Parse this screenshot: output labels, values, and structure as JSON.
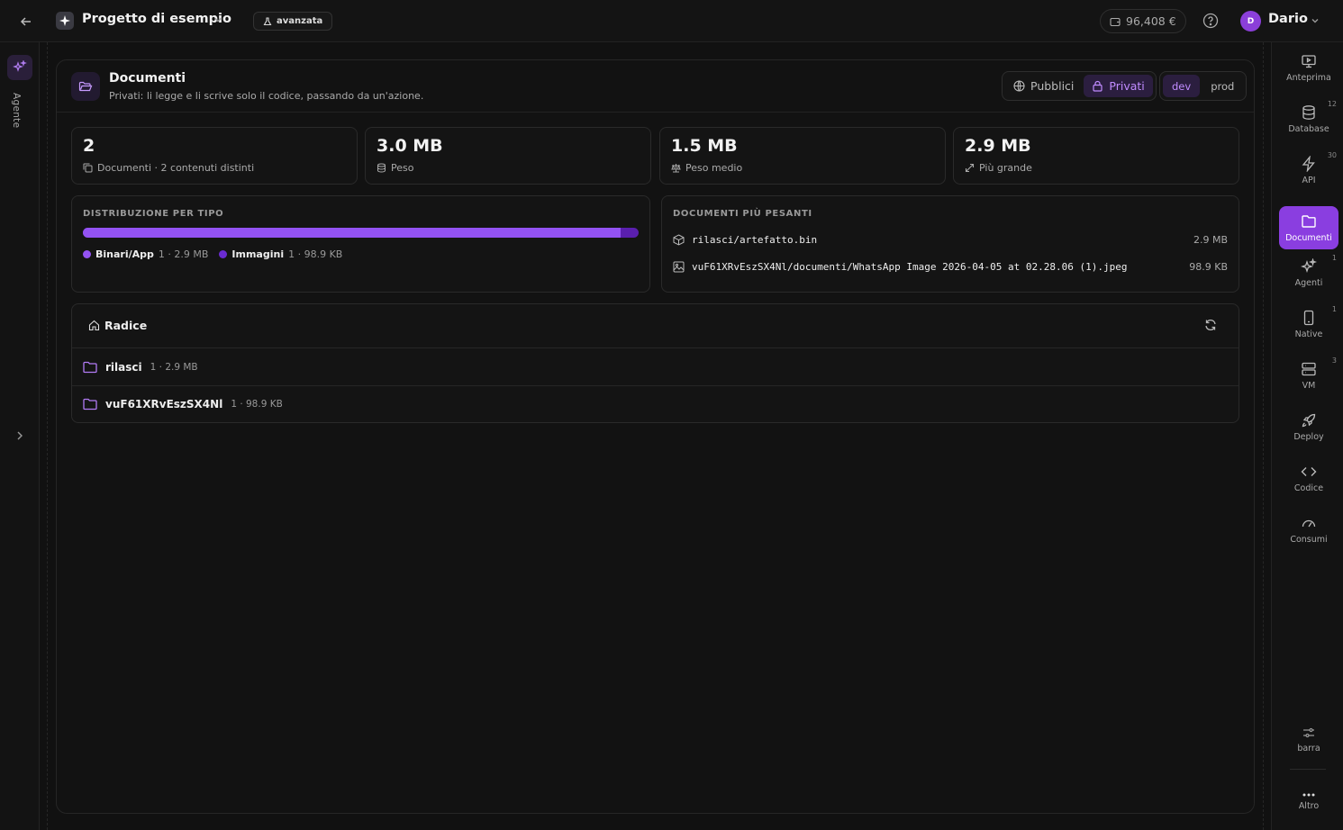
{
  "topbar": {
    "project_name": "Progetto di esempio",
    "mode_badge": "avanzata",
    "credit": "96,408 €",
    "user_initial": "D",
    "user_name": "Dario"
  },
  "left_rail": {
    "agent_label": "Agente"
  },
  "right_rail": {
    "items": [
      {
        "label": "Anteprima",
        "icon": "monitor-icon",
        "count": ""
      },
      {
        "label": "Database",
        "icon": "database-icon",
        "count": "12"
      },
      {
        "label": "API",
        "icon": "bolt-icon",
        "count": "30"
      },
      {
        "label": "Documenti",
        "icon": "folder-icon",
        "count": "",
        "active": true
      },
      {
        "label": "Agenti",
        "icon": "sparkles-icon",
        "count": "1"
      },
      {
        "label": "Native",
        "icon": "phone-icon",
        "count": "1"
      },
      {
        "label": "VM",
        "icon": "server-icon",
        "count": "3"
      },
      {
        "label": "Deploy",
        "icon": "rocket-icon",
        "count": ""
      },
      {
        "label": "Codice",
        "icon": "code-icon",
        "count": ""
      },
      {
        "label": "Consumi",
        "icon": "gauge-icon",
        "count": ""
      }
    ],
    "bottom": [
      {
        "label": "barra",
        "icon": "sliders-icon"
      },
      {
        "label": "Altro",
        "icon": "more-icon"
      }
    ]
  },
  "documents": {
    "title": "Documenti",
    "subtitle": "Privati: li legge e li scrive solo il codice, passando da un'azione.",
    "visibility": {
      "public_label": "Pubblici",
      "private_label": "Privati",
      "selected": "Privati"
    },
    "env": {
      "dev_label": "dev",
      "prod_label": "prod",
      "selected": "dev"
    }
  },
  "stats": [
    {
      "value": "2",
      "caption": "Documenti · 2 contenuti distinti",
      "icon": "copy-icon"
    },
    {
      "value": "3.0 MB",
      "caption": "Peso",
      "icon": "database-icon"
    },
    {
      "value": "1.5 MB",
      "caption": "Peso medio",
      "icon": "scale-icon"
    },
    {
      "value": "2.9 MB",
      "caption": "Più grande",
      "icon": "expand-icon"
    }
  ],
  "distribution": {
    "title": "DISTRIBUZIONE PER TIPO",
    "share_binari": 0.968,
    "items": [
      {
        "name": "Binari/App",
        "meta": "1 · 2.9 MB",
        "color": "#9352f2"
      },
      {
        "name": "Immagini",
        "meta": "1 · 98.9 KB",
        "color": "#6a2bd1"
      }
    ]
  },
  "heaviest": {
    "title": "DOCUMENTI PIÙ PESANTI",
    "files": [
      {
        "path": "rilasci/artefatto.bin",
        "size": "2.9 MB",
        "icon": "package-icon"
      },
      {
        "path": "vuF61XRvEszSX4Nl/documenti/WhatsApp Image 2026-04-05 at 02.28.06 (1).jpeg",
        "size": "98.9 KB",
        "icon": "image-icon"
      }
    ]
  },
  "tree": {
    "root_label": "Radice",
    "folders": [
      {
        "name": "rilasci",
        "meta": "1 · 2.9 MB"
      },
      {
        "name": "vuF61XRvEszSX4Nl",
        "meta": "1 · 98.9 KB"
      }
    ]
  },
  "colors": {
    "accent": "#8a3ee0",
    "background": "#111111"
  }
}
